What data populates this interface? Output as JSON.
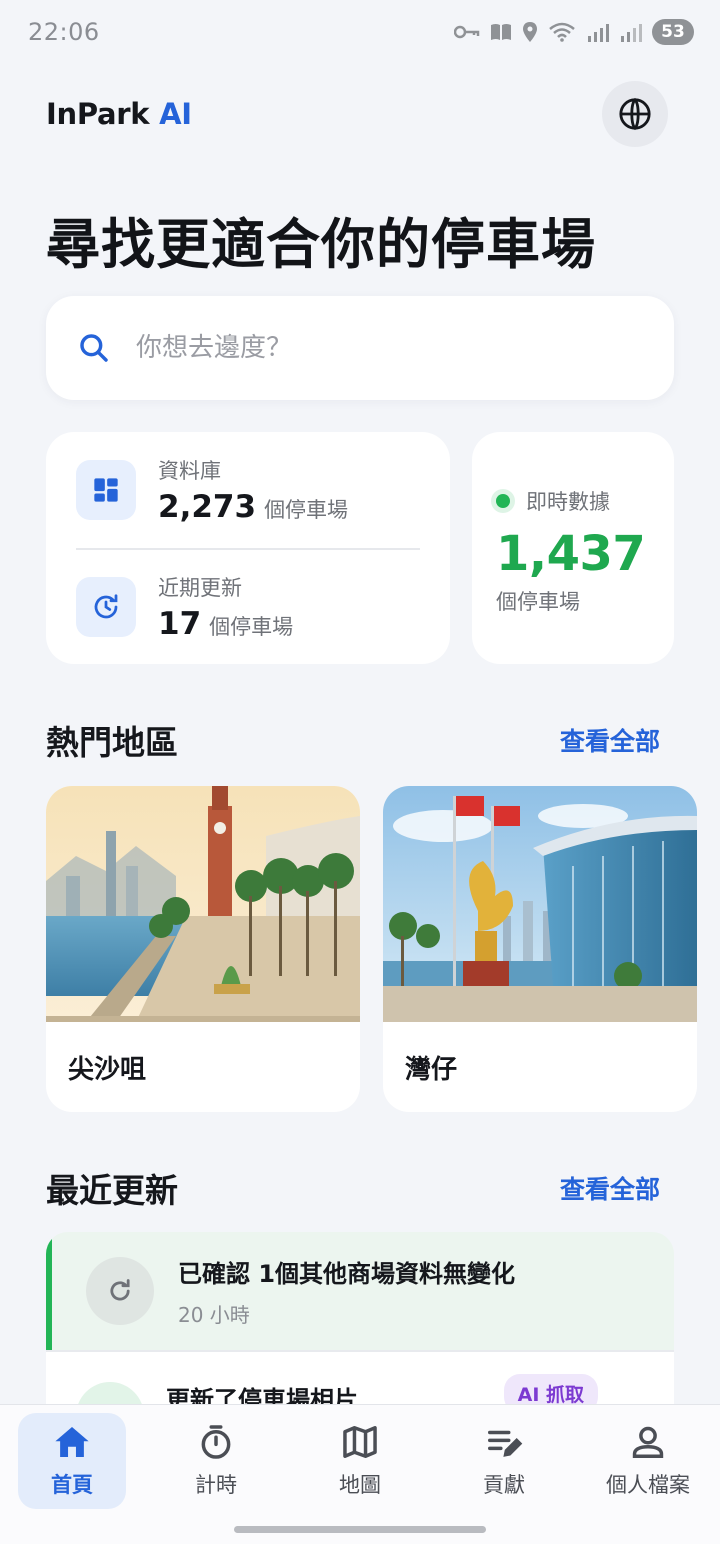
{
  "status_bar": {
    "time": "22:06",
    "battery": "53"
  },
  "header": {
    "brand": "InPark",
    "brand_accent": "AI"
  },
  "hero": {
    "title": "尋找更適合你的停車場"
  },
  "search": {
    "placeholder": "你想去邊度？"
  },
  "stats": {
    "database": {
      "label": "資料庫",
      "value": "2,273",
      "unit": "個停車場"
    },
    "recent": {
      "label": "近期更新",
      "value": "17",
      "unit": "個停車場"
    },
    "live": {
      "label": "即時數據",
      "value": "1,437",
      "unit": "個停車場"
    }
  },
  "popular": {
    "title": "熱門地區",
    "view_all": "查看全部",
    "districts": [
      {
        "name": "尖沙咀"
      },
      {
        "name": "灣仔"
      }
    ]
  },
  "updates": {
    "title": "最近更新",
    "view_all": "查看全部",
    "items": [
      {
        "title": "已確認 1個其他商場資料無變化",
        "time": "20 小時"
      },
      {
        "title": "更新了停車場相片",
        "badge": "AI 抓取"
      }
    ]
  },
  "nav": {
    "items": [
      {
        "label": "首頁",
        "icon": "home-icon"
      },
      {
        "label": "計時",
        "icon": "timer-icon"
      },
      {
        "label": "地圖",
        "icon": "map-icon"
      },
      {
        "label": "貢獻",
        "icon": "contribute-icon"
      },
      {
        "label": "個人檔案",
        "icon": "profile-icon"
      }
    ]
  },
  "colors": {
    "accent": "#2563d9",
    "live": "#1fa84f",
    "ai_badge": "#7c3ad1"
  }
}
